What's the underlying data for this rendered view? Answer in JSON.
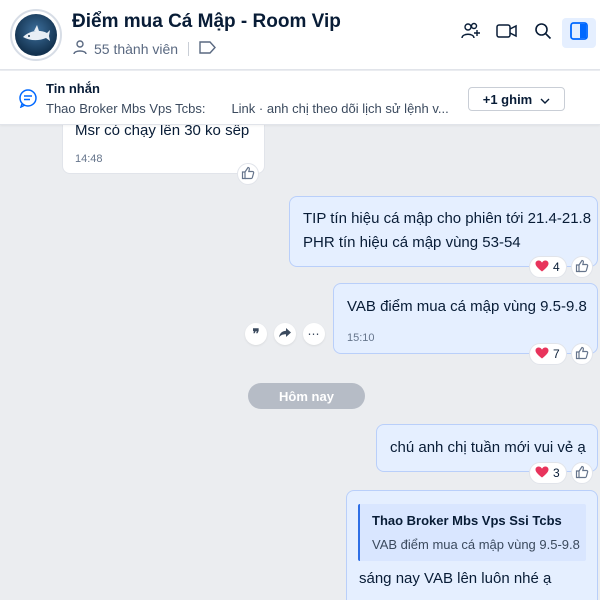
{
  "header": {
    "title": "Điểm mua Cá Mập - Room Vip",
    "members": "55 thành viên"
  },
  "pinned": {
    "title": "Tin nhắn",
    "sender": "Thao Broker Mbs Vps Tcbs:",
    "text": "Link · anh chị theo dõi lịch sử lệnh v...",
    "button": "+1 ghim"
  },
  "messages": [
    {
      "text": "Msr có chạy lên 30 ko sếp",
      "time": "14:48"
    },
    {
      "lines": [
        "TIP tín hiệu cá mập cho phiên tới 21.4-21.8",
        "PHR tín hiệu cá mập vùng 53-54"
      ],
      "reaction_count": "4"
    },
    {
      "text": "VAB điểm mua cá mập vùng 9.5-9.8",
      "time": "15:10",
      "reaction_count": "7"
    },
    {
      "text": "chú anh chị tuần mới vui vẻ ạ",
      "reaction_count": "3"
    },
    {
      "quote_name": "Thao Broker Mbs Vps Ssi Tcbs",
      "quote_text": "VAB điểm mua cá mập vùng 9.5-9.8",
      "text": "sáng nay VAB lên luôn nhé ạ"
    }
  ],
  "date_divider": "Hôm nay",
  "colors": {
    "accent": "#0068ff",
    "bubble_out": "#e5efff",
    "bubble_in": "#ffffff",
    "background": "#ebedf0",
    "heart": "#e8345c"
  },
  "icons": {
    "add_member": "user-plus-icon",
    "video": "video-icon",
    "search": "search-icon",
    "panel": "sidebar-panel-icon",
    "members": "user-icon",
    "tag": "tag-icon",
    "pinned": "message-icon"
  }
}
